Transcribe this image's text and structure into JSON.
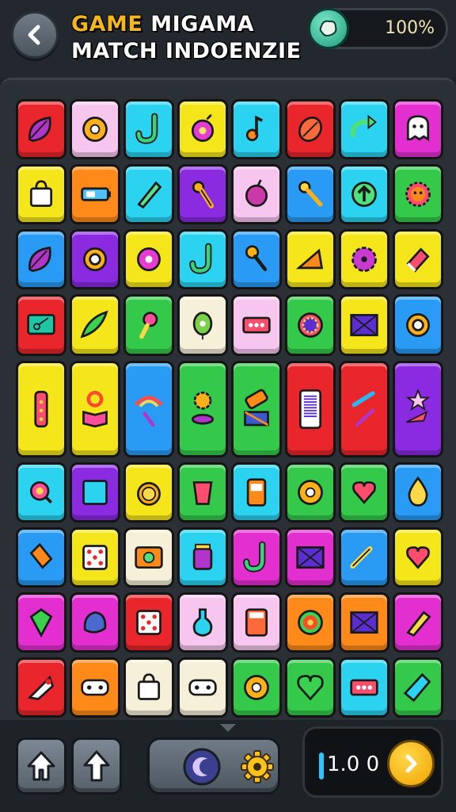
{
  "header": {
    "title_word1": "GAME",
    "title_word2": "MIGAMA",
    "subtitle": "MATCH INDOENZIE",
    "coins_percent": "100%"
  },
  "colors": {
    "red": "#e8262b",
    "pink": "#f7c6ee",
    "cyan": "#2bd3f0",
    "yellow": "#f5e61c",
    "orange": "#ff8a1a",
    "purple": "#8a2be2",
    "green": "#34c94a",
    "magenta": "#e32fd0",
    "blue": "#2a9bf5",
    "cream": "#f7f0d8"
  },
  "board": {
    "row1": [
      {
        "color": "red",
        "icon": "leaf-icon"
      },
      {
        "color": "pink",
        "icon": "donut-icon"
      },
      {
        "color": "cyan",
        "icon": "hook-icon"
      },
      {
        "color": "yellow",
        "icon": "swirl-icon"
      },
      {
        "color": "cyan",
        "icon": "note-icon"
      },
      {
        "color": "red",
        "icon": "seed-icon"
      },
      {
        "color": "cyan",
        "icon": "arrow-loop-icon"
      },
      {
        "color": "magenta",
        "icon": "ghost-icon"
      }
    ],
    "row2": [
      {
        "color": "yellow",
        "icon": "bag-icon"
      },
      {
        "color": "orange",
        "icon": "battery-icon"
      },
      {
        "color": "cyan",
        "icon": "pen-icon"
      },
      {
        "color": "purple",
        "icon": "tool-icon"
      },
      {
        "color": "pink",
        "icon": "apple-icon"
      },
      {
        "color": "blue",
        "icon": "pin-icon"
      },
      {
        "color": "cyan",
        "icon": "up-arrow-icon"
      },
      {
        "color": "green",
        "icon": "sun-icon"
      }
    ],
    "row3": [
      {
        "color": "blue",
        "icon": "leaf-icon"
      },
      {
        "color": "purple",
        "icon": "ring-icon"
      },
      {
        "color": "yellow",
        "icon": "flower-icon"
      },
      {
        "color": "cyan",
        "icon": "hook-icon"
      },
      {
        "color": "blue",
        "icon": "key-icon"
      },
      {
        "color": "yellow",
        "icon": "box-icon"
      },
      {
        "color": "yellow",
        "icon": "gear-icon"
      },
      {
        "color": "yellow",
        "icon": "eraser-icon"
      }
    ],
    "row4": [
      {
        "color": "red",
        "icon": "screen-icon"
      },
      {
        "color": "yellow",
        "icon": "feather-icon"
      },
      {
        "color": "green",
        "icon": "brush-icon"
      },
      {
        "color": "cream",
        "icon": "balloon-icon"
      },
      {
        "color": "pink",
        "icon": "tape-icon"
      },
      {
        "color": "green",
        "icon": "palette-icon"
      },
      {
        "color": "yellow",
        "icon": "envelope-icon"
      },
      {
        "color": "blue",
        "icon": "ring-icon"
      }
    ],
    "row5": [
      {
        "color": "yellow",
        "icon": "remote-icon"
      },
      {
        "color": "yellow",
        "icon": "book-icon"
      },
      {
        "color": "blue",
        "icon": "rainbow-icon"
      },
      {
        "color": "green",
        "icon": "cookie-icon"
      },
      {
        "color": "green",
        "icon": "bandage-icon"
      },
      {
        "color": "red",
        "icon": "barcode-icon"
      },
      {
        "color": "red",
        "icon": "wrench-icon"
      },
      {
        "color": "purple",
        "icon": "star-icon"
      }
    ],
    "row6": [
      {
        "color": "cyan",
        "icon": "search-icon"
      },
      {
        "color": "purple",
        "icon": "square-icon"
      },
      {
        "color": "yellow",
        "icon": "clock-icon"
      },
      {
        "color": "green",
        "icon": "cup-icon"
      },
      {
        "color": "cyan",
        "icon": "radio-icon"
      },
      {
        "color": "green",
        "icon": "donut-icon"
      },
      {
        "color": "green",
        "icon": "heart-bubble-icon"
      },
      {
        "color": "blue",
        "icon": "drop-icon"
      }
    ],
    "row7": [
      {
        "color": "blue",
        "icon": "marker-icon"
      },
      {
        "color": "yellow",
        "icon": "dice-icon"
      },
      {
        "color": "cream",
        "icon": "camera-icon"
      },
      {
        "color": "cyan",
        "icon": "jar-icon"
      },
      {
        "color": "magenta",
        "icon": "hook-icon"
      },
      {
        "color": "magenta",
        "icon": "envelope-icon"
      },
      {
        "color": "blue",
        "icon": "trumpet-icon"
      },
      {
        "color": "yellow",
        "icon": "heart-bubble-icon"
      }
    ],
    "row8": [
      {
        "color": "magenta",
        "icon": "gem-icon"
      },
      {
        "color": "magenta",
        "icon": "blob-icon"
      },
      {
        "color": "red",
        "icon": "dice-icon"
      },
      {
        "color": "pink",
        "icon": "flask-icon"
      },
      {
        "color": "pink",
        "icon": "calculator-icon"
      },
      {
        "color": "orange",
        "icon": "target-icon"
      },
      {
        "color": "orange",
        "icon": "envelope-icon"
      },
      {
        "color": "magenta",
        "icon": "pencil-icon"
      }
    ],
    "row9": [
      {
        "color": "red",
        "icon": "rocket-icon"
      },
      {
        "color": "orange",
        "icon": "gamepad-icon"
      },
      {
        "color": "cream",
        "icon": "bag-icon"
      },
      {
        "color": "cream",
        "icon": "gamepad-icon"
      },
      {
        "color": "green",
        "icon": "donut-icon"
      },
      {
        "color": "green",
        "icon": "heart-icon"
      },
      {
        "color": "cyan",
        "icon": "tape-icon"
      },
      {
        "color": "green",
        "icon": "kite-icon"
      }
    ]
  },
  "footer": {
    "score": "1.0 0"
  }
}
